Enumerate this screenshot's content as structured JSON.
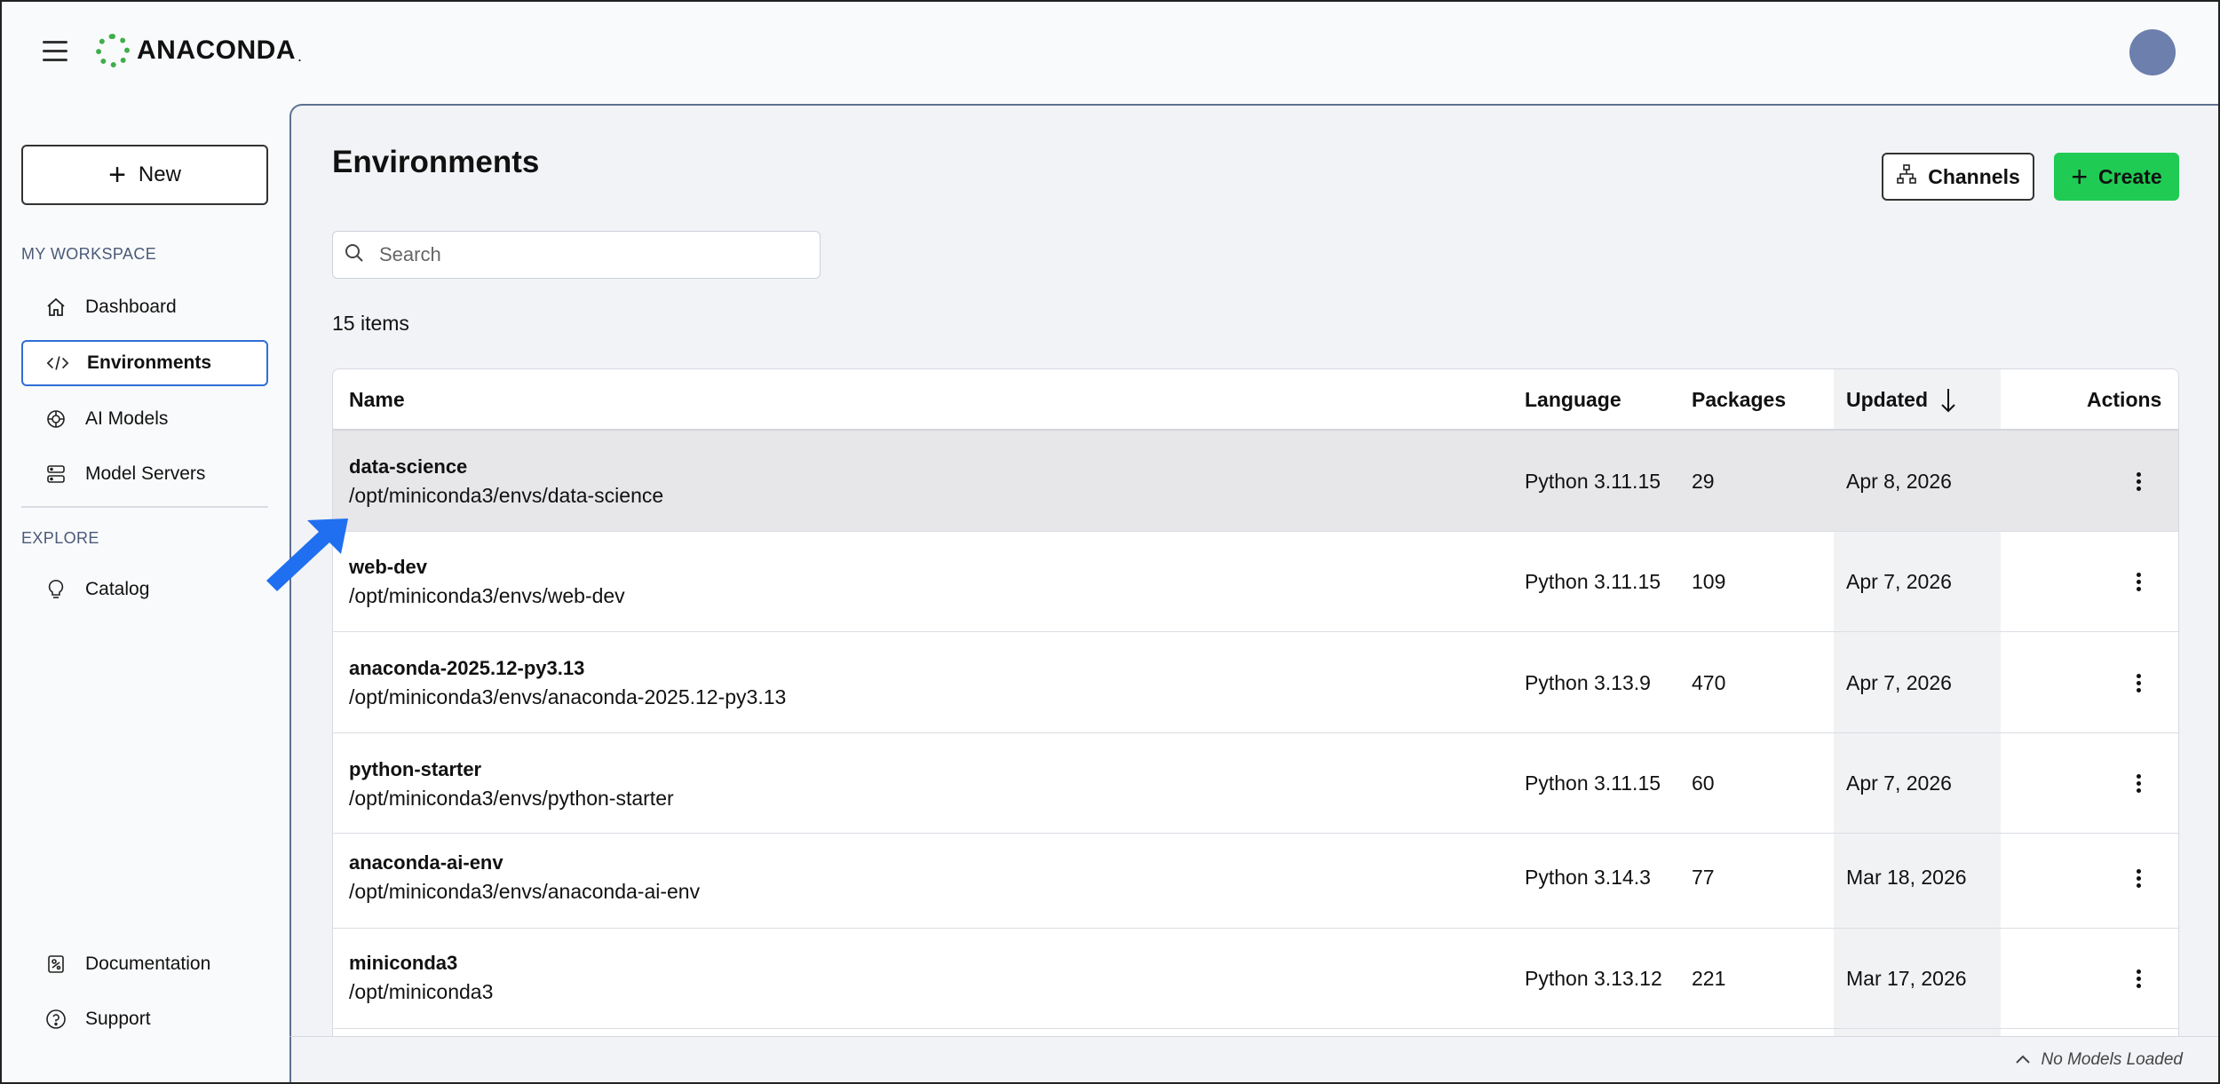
{
  "app": {
    "logo_text": "ANACONDA",
    "logo_suffix": "."
  },
  "sidebar": {
    "new_label": "New",
    "workspace_label": "MY WORKSPACE",
    "workspace_items": [
      {
        "label": "Dashboard",
        "icon": "home-icon"
      },
      {
        "label": "Environments",
        "icon": "code-icon"
      },
      {
        "label": "AI Models",
        "icon": "ai-models-icon"
      },
      {
        "label": "Model Servers",
        "icon": "server-icon"
      }
    ],
    "explore_label": "EXPLORE",
    "explore_items": [
      {
        "label": "Catalog",
        "icon": "lightbulb-icon"
      }
    ],
    "bottom_items": [
      {
        "label": "Documentation",
        "icon": "documentation-icon"
      },
      {
        "label": "Support",
        "icon": "help-icon"
      }
    ]
  },
  "main": {
    "title": "Environments",
    "channels_label": "Channels",
    "create_label": "Create",
    "search_placeholder": "Search",
    "items_count": "15 items"
  },
  "table": {
    "columns": {
      "name": "Name",
      "language": "Language",
      "packages": "Packages",
      "updated": "Updated",
      "actions": "Actions"
    },
    "rows": [
      {
        "name": "data-science",
        "path": "/opt/miniconda3/envs/data-science",
        "language": "Python 3.11.15",
        "packages": "29",
        "updated": "Apr 8, 2026"
      },
      {
        "name": "web-dev",
        "path": "/opt/miniconda3/envs/web-dev",
        "language": "Python 3.11.15",
        "packages": "109",
        "updated": "Apr 7, 2026"
      },
      {
        "name": "anaconda-2025.12-py3.13",
        "path": "/opt/miniconda3/envs/anaconda-2025.12-py3.13",
        "language": "Python 3.13.9",
        "packages": "470",
        "updated": "Apr 7, 2026"
      },
      {
        "name": "python-starter",
        "path": "/opt/miniconda3/envs/python-starter",
        "language": "Python 3.11.15",
        "packages": "60",
        "updated": "Apr 7, 2026"
      },
      {
        "name": "anaconda-ai-env",
        "path": "/opt/miniconda3/envs/anaconda-ai-env",
        "language": "Python 3.14.3",
        "packages": "77",
        "updated": "Mar 18, 2026"
      },
      {
        "name": "miniconda3",
        "path": "/opt/miniconda3",
        "language": "Python 3.13.12",
        "packages": "221",
        "updated": "Mar 17, 2026"
      }
    ]
  },
  "footer": {
    "status": "No Models Loaded"
  },
  "colors": {
    "accent_green": "#1fcb53",
    "active_border": "#2f6fd6",
    "arrow_blue": "#1f6ff0"
  }
}
